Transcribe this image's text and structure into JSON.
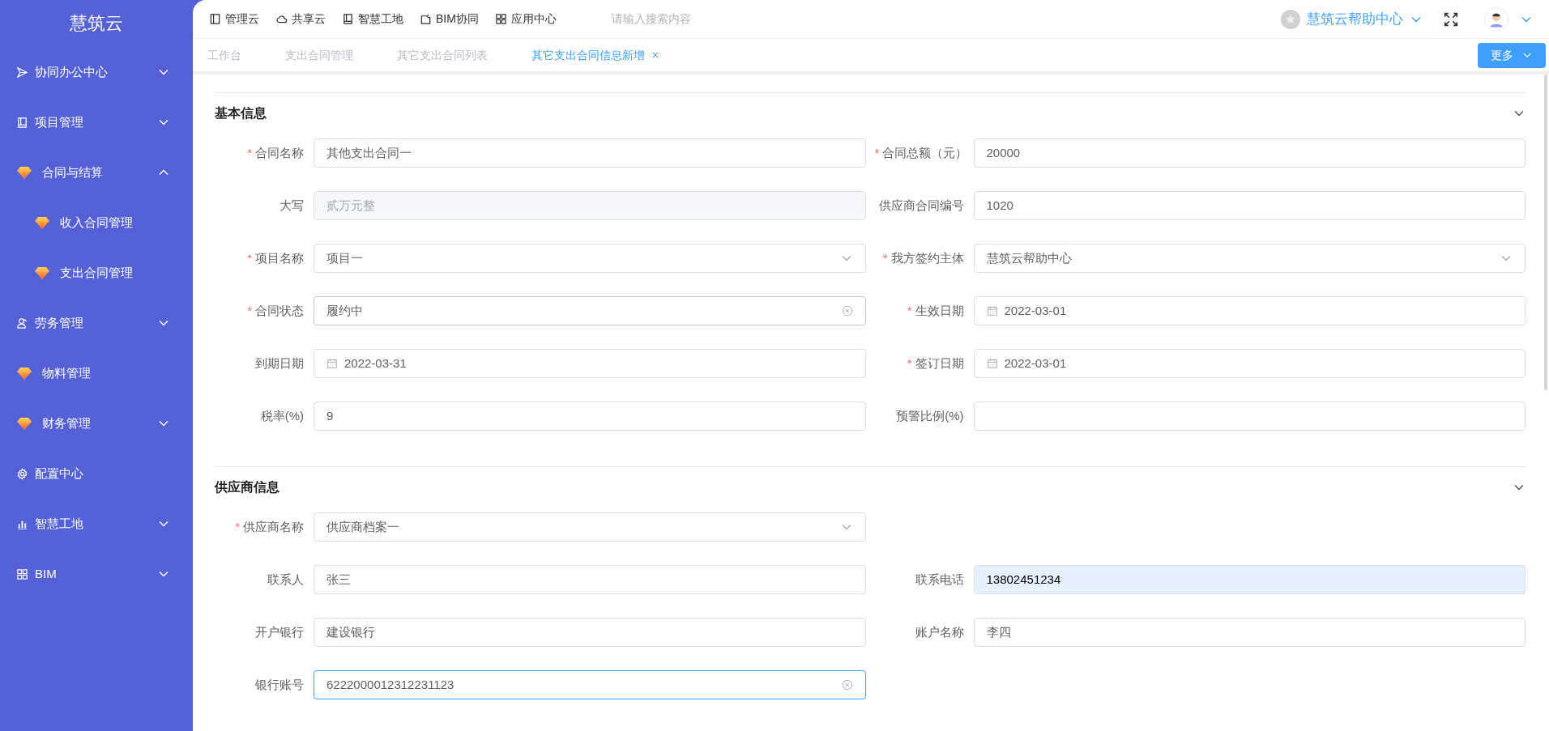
{
  "sidebar": {
    "title": "慧筑云",
    "items": [
      {
        "label": "协同办公中心",
        "expanded": false
      },
      {
        "label": "项目管理",
        "expanded": false
      },
      {
        "label": "合同与结算",
        "expanded": true,
        "children": [
          {
            "label": "收入合同管理"
          },
          {
            "label": "支出合同管理"
          }
        ]
      },
      {
        "label": "劳务管理",
        "expanded": false
      },
      {
        "label": "物料管理"
      },
      {
        "label": "财务管理",
        "expanded": false
      },
      {
        "label": "配置中心"
      },
      {
        "label": "智慧工地",
        "expanded": false
      },
      {
        "label": "BIM",
        "expanded": false
      }
    ]
  },
  "topbar": {
    "nav": [
      {
        "label": "管理云"
      },
      {
        "label": "共享云"
      },
      {
        "label": "智慧工地"
      },
      {
        "label": "BIM协同"
      },
      {
        "label": "应用中心"
      }
    ],
    "search": {
      "placeholder": "请输入搜索内容"
    },
    "help": "慧筑云帮助中心"
  },
  "tabs": [
    {
      "label": "工作台",
      "selected": false,
      "closable": false
    },
    {
      "label": "支出合同管理",
      "selected": false,
      "closable": false
    },
    {
      "label": "其它支出合同列表",
      "selected": false,
      "closable": false
    },
    {
      "label": "其它支出合同信息新增",
      "selected": true,
      "closable": true
    }
  ],
  "more_button": "更多",
  "sections": [
    {
      "title": "基本信息",
      "expanded": true,
      "rows": [
        [
          {
            "required_mark": "*",
            "label": "合同名称",
            "kind": "text",
            "value": "其他支出合同一",
            "hovered": false,
            "focused": false,
            "autofilled": false
          },
          {
            "required_mark": "*",
            "label": "合同总额（元）",
            "kind": "text",
            "value": "20000",
            "hovered": false,
            "focused": false,
            "autofilled": false
          }
        ],
        [
          {
            "label": "大写",
            "kind": "disabled",
            "value": "贰万元整",
            "hovered": false,
            "focused": false,
            "autofilled": false
          },
          {
            "label": "供应商合同编号",
            "kind": "text",
            "value": "1020",
            "hovered": false,
            "focused": false,
            "autofilled": false
          }
        ],
        [
          {
            "required_mark": "*",
            "label": "项目名称",
            "kind": "select",
            "value": "项目一",
            "hovered": false,
            "focused": false,
            "autofilled": false
          },
          {
            "required_mark": "*",
            "label": "我方签约主体",
            "kind": "select",
            "value": "慧筑云帮助中心",
            "hovered": false,
            "focused": false,
            "autofilled": false
          }
        ],
        [
          {
            "required_mark": "*",
            "label": "合同状态",
            "kind": "text",
            "value": "履约中",
            "hovered": true,
            "focused": false,
            "autofilled": false
          },
          {
            "required_mark": "*",
            "label": "生效日期",
            "kind": "date",
            "value": "2022-03-01",
            "hovered": false,
            "focused": false,
            "autofilled": false
          }
        ],
        [
          {
            "label": "到期日期",
            "kind": "date",
            "value": "2022-03-31",
            "hovered": false,
            "focused": false,
            "autofilled": false
          },
          {
            "required_mark": "*",
            "label": "签订日期",
            "kind": "date",
            "value": "2022-03-01",
            "hovered": false,
            "focused": false,
            "autofilled": false
          }
        ],
        [
          {
            "label": "税率(%)",
            "kind": "text",
            "value": "9",
            "hovered": false,
            "focused": false,
            "autofilled": false
          },
          {
            "label": "预警比例(%)",
            "kind": "text",
            "hovered": false,
            "focused": false,
            "autofilled": false
          }
        ]
      ]
    },
    {
      "title": "供应商信息",
      "expanded": true,
      "rows": [
        [
          {
            "required_mark": "*",
            "label": "供应商名称",
            "kind": "select",
            "value": "供应商档案一",
            "hovered": false,
            "focused": false,
            "autofilled": false
          }
        ],
        [
          {
            "label": "联系人",
            "kind": "text",
            "value": "张三",
            "hovered": false,
            "focused": false,
            "autofilled": false
          },
          {
            "label": "联系电话",
            "kind": "text",
            "value": "13802451234",
            "hovered": false,
            "focused": false,
            "autofilled": true
          }
        ],
        [
          {
            "label": "开户银行",
            "kind": "text",
            "value": "建设银行",
            "hovered": false,
            "focused": false,
            "autofilled": false
          },
          {
            "label": "账户名称",
            "kind": "text",
            "value": "李四",
            "hovered": false,
            "focused": false,
            "autofilled": false
          }
        ],
        [
          {
            "label": "银行账号",
            "kind": "text",
            "value": "6222000012312231123",
            "hovered": false,
            "focused": true,
            "autofilled": false
          }
        ]
      ]
    }
  ]
}
